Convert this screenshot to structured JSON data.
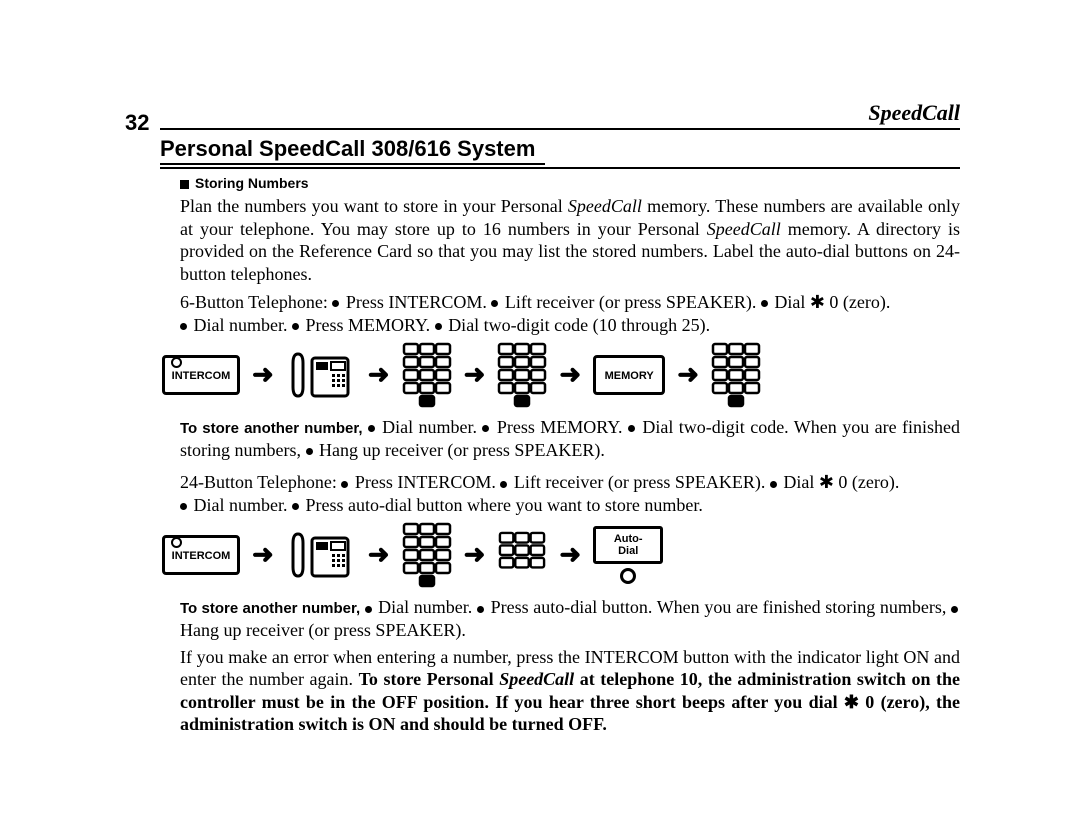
{
  "page_number": "32",
  "running_head": "SpeedCall",
  "section_title": "Personal SpeedCall 308/616 System",
  "sub_head": "Storing  Numbers",
  "intro_line1a": "Plan the numbers you want to store in your Personal ",
  "intro_line1_speedcall": "SpeedCall",
  "intro_line1b": " memory. These numbers are available only at your telephone. You may store up to 16 numbers in your Personal ",
  "intro_line1c": " memory. A directory is provided on the Reference Card so that you may list the stored numbers. Label the auto-dial buttons on 24-button telephones.",
  "six_btn_lead": "6-Button Telephone: ",
  "press_intercom": "Press INTERCOM. ",
  "lift_receiver": "Lift receiver (or press SPEAKER). ",
  "dial_star0": "Dial ✱ 0 (zero).",
  "dial_number": "Dial number. ",
  "press_memory": "Press MEMORY. ",
  "dial_twodigit": "Dial two-digit code (10 through 25).",
  "dial_twodigit2": "Dial two-digit code. When you are",
  "store_another_lead": "To  store another number, ",
  "store_another_lead2": "To store another number, ",
  "finished_storing": "finished storing numbers, ",
  "hang_up": "Hang up receiver (or press SPEAKER).",
  "twentyfour_lead": "24-Button Telephone: ",
  "press_autodial_where": "Press auto-dial button where you want to store number.",
  "press_autodial": "Press auto-dial button. When you are finished storing",
  "numbers_comma": "numbers, ",
  "error_para_a": "If you make an error when entering a number, press the INTERCOM button with the indicator light ON and enter the number again. ",
  "error_para_bold1": "To store Personal ",
  "error_para_bold_speedcall": "SpeedCall",
  "error_para_bold2": " at telephone 10, the administration switch on the controller must be in the OFF position. If you hear three short beeps after you dial ✱ 0 (zero), the administration switch is ON and should be turned OFF.",
  "intercom_label": "INTERCOM",
  "memory_label": "MEMORY",
  "autodial_label": "Auto-Dial"
}
